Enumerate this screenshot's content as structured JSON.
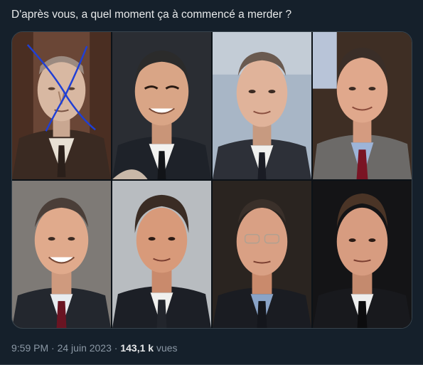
{
  "tweet": {
    "text": "D'après vous, a quel moment ça à commencé a merder ?",
    "time": "9:59 PM",
    "separator": "·",
    "date": "24 juin 2023",
    "views_count": "143,1 k",
    "views_label": "vues"
  },
  "media": {
    "photos": [
      {
        "name": "portrait-1",
        "crossed_out": true,
        "cross_color": "#1f3fd6"
      },
      {
        "name": "portrait-2",
        "crossed_out": false
      },
      {
        "name": "portrait-3",
        "crossed_out": false
      },
      {
        "name": "portrait-4",
        "crossed_out": false
      },
      {
        "name": "portrait-5",
        "crossed_out": false
      },
      {
        "name": "portrait-6",
        "crossed_out": false
      },
      {
        "name": "portrait-7",
        "crossed_out": false
      },
      {
        "name": "portrait-8",
        "crossed_out": false
      }
    ]
  },
  "colors": {
    "background": "#15202b",
    "text": "#e7e9ea",
    "muted": "#8b98a5",
    "border": "#38444d"
  }
}
